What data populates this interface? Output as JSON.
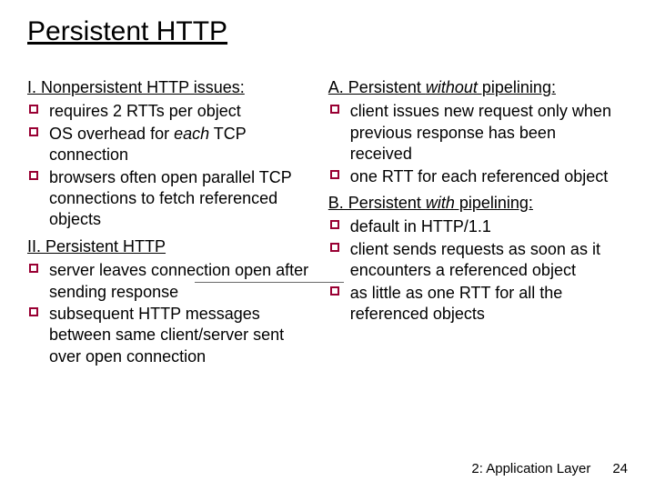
{
  "title": "Persistent HTTP",
  "left": {
    "h1_prefix": "I. ",
    "h1_label": "Nonpersistent HTTP issues:",
    "list1": [
      "requires 2 RTTs per object",
      "OS overhead for each TCP connection",
      "browsers often open parallel TCP connections to fetch referenced objects"
    ],
    "h2_prefix": "II. ",
    "h2_label": "Persistent  HTTP",
    "list2": [
      "server leaves connection open after sending response",
      "subsequent HTTP messages between same client/server sent over open connection"
    ]
  },
  "right": {
    "hA_prefix": "A. Persistent ",
    "hA_word": "without",
    "hA_suffix": " pipelining:",
    "listA": [
      "client issues new request only when previous response has been received",
      "one RTT for each referenced object"
    ],
    "hB_prefix": "B. Persistent ",
    "hB_word": "with",
    "hB_suffix": " pipelining:",
    "listB": [
      "default in HTTP/1.1",
      "client sends requests as soon as it encounters a referenced object",
      "as little as one RTT for all the referenced objects"
    ]
  },
  "footer": {
    "chapter": "2: Application Layer",
    "page": "24"
  },
  "list1_italic_seg": {
    "index": 1,
    "before": "OS overhead for ",
    "italic": "each",
    "after": " TCP connection"
  }
}
